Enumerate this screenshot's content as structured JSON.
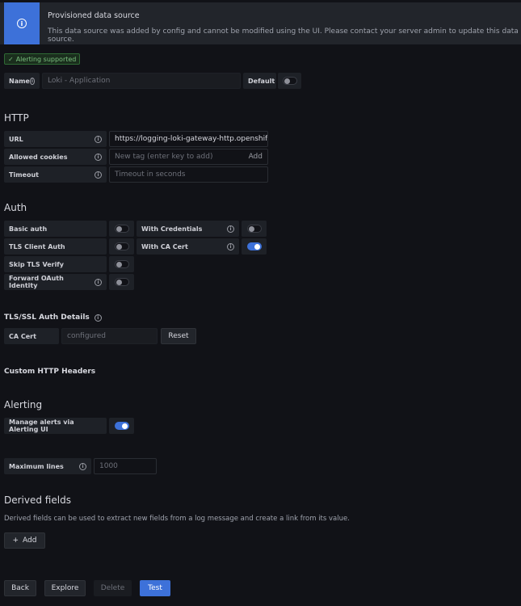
{
  "banner": {
    "title": "Provisioned data source",
    "description": "This data source was added by config and cannot be modified using the UI. Please contact your server admin to update this data source."
  },
  "badge": "Alerting supported",
  "name": {
    "label": "Name",
    "placeholder": "Loki - Application",
    "default_label": "Default",
    "default_on": false
  },
  "http": {
    "heading": "HTTP",
    "url_label": "URL",
    "url_value": "https://logging-loki-gateway-http.openshift...",
    "cookies_label": "Allowed cookies",
    "cookies_placeholder": "New tag (enter key to add)",
    "cookies_add": "Add",
    "timeout_label": "Timeout",
    "timeout_placeholder": "Timeout in seconds"
  },
  "auth": {
    "heading": "Auth",
    "basic": "Basic auth",
    "with_credentials": "With Credentials",
    "tls_client": "TLS Client Auth",
    "with_ca": "With CA Cert",
    "skip_tls": "Skip TLS Verify",
    "forward_oauth": "Forward OAuth Identity"
  },
  "tls": {
    "heading": "TLS/SSL Auth Details",
    "ca_label": "CA Cert",
    "ca_value": "configured",
    "reset": "Reset"
  },
  "custom_headers": "Custom HTTP Headers",
  "alerting": {
    "heading": "Alerting",
    "manage_label": "Manage alerts via Alerting UI"
  },
  "max_lines": {
    "label": "Maximum lines",
    "placeholder": "1000"
  },
  "derived": {
    "heading": "Derived fields",
    "description": "Derived fields can be used to extract new fields from a log message and create a link from its value.",
    "add": "Add"
  },
  "footer": {
    "back": "Back",
    "explore": "Explore",
    "delete": "Delete",
    "test": "Test"
  }
}
